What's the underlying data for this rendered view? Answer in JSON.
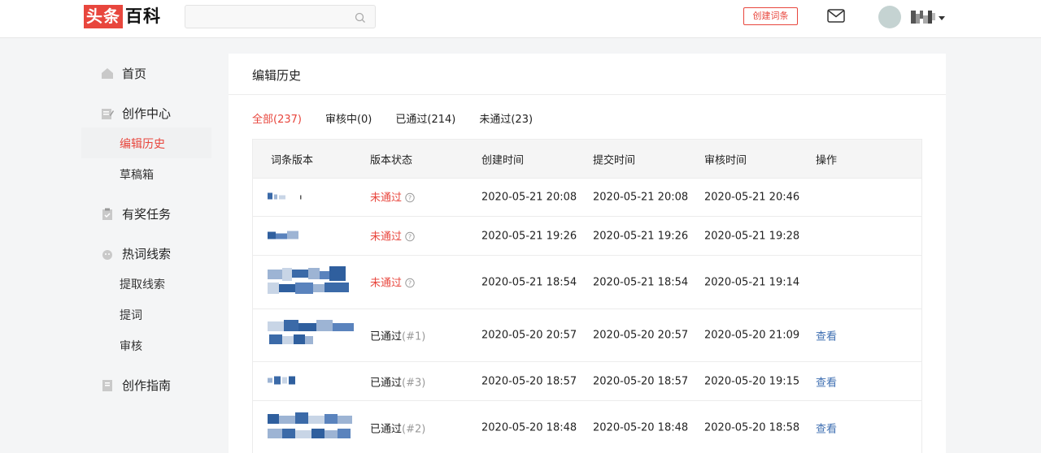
{
  "header": {
    "logo_part1": "头条",
    "logo_part2": "百科",
    "search_placeholder": "",
    "create_button": "创建词条",
    "icons": {
      "search": "search-icon",
      "mail": "mail-icon",
      "caret": "caret-down-icon"
    }
  },
  "sidebar": {
    "items": [
      {
        "label": "首页",
        "icon": "home-icon"
      },
      {
        "label": "创作中心",
        "icon": "edit-icon"
      },
      {
        "label": "编辑历史",
        "active": true
      },
      {
        "label": "草稿箱"
      },
      {
        "label": "有奖任务",
        "icon": "clipboard-icon"
      },
      {
        "label": "热词线索",
        "icon": "fire-icon"
      },
      {
        "label": "提取线索"
      },
      {
        "label": "提词"
      },
      {
        "label": "审核"
      },
      {
        "label": "创作指南",
        "icon": "book-icon"
      }
    ]
  },
  "main": {
    "title": "编辑历史",
    "tabs": [
      {
        "label": "全部(237)",
        "active": true
      },
      {
        "label": "审核中(0)"
      },
      {
        "label": "已通过(214)"
      },
      {
        "label": "未通过(23)"
      }
    ],
    "columns": [
      "词条版本",
      "版本状态",
      "创建时间",
      "提交时间",
      "审核时间",
      "操作"
    ],
    "rows": [
      {
        "status": "未通过",
        "version": "",
        "created": "2020-05-21 20:08",
        "submitted": "2020-05-21 20:08",
        "reviewed": "2020-05-21 20:46",
        "action": ""
      },
      {
        "status": "未通过",
        "version": "",
        "created": "2020-05-21 19:26",
        "submitted": "2020-05-21 19:26",
        "reviewed": "2020-05-21 19:28",
        "action": ""
      },
      {
        "status": "未通过",
        "version": "",
        "created": "2020-05-21 18:54",
        "submitted": "2020-05-21 18:54",
        "reviewed": "2020-05-21 19:14",
        "action": ""
      },
      {
        "status": "已通过",
        "version": "(#1)",
        "created": "2020-05-20 20:57",
        "submitted": "2020-05-20 20:57",
        "reviewed": "2020-05-20 21:09",
        "action": "查看"
      },
      {
        "status": "已通过",
        "version": "(#3)",
        "created": "2020-05-20 18:57",
        "submitted": "2020-05-20 18:57",
        "reviewed": "2020-05-20 19:15",
        "action": "查看"
      },
      {
        "status": "已通过",
        "version": "(#2)",
        "created": "2020-05-20 18:48",
        "submitted": "2020-05-20 18:48",
        "reviewed": "2020-05-20 18:58",
        "action": "查看"
      }
    ]
  },
  "colors": {
    "accent": "#e8463d",
    "link": "#3f6fb2"
  }
}
